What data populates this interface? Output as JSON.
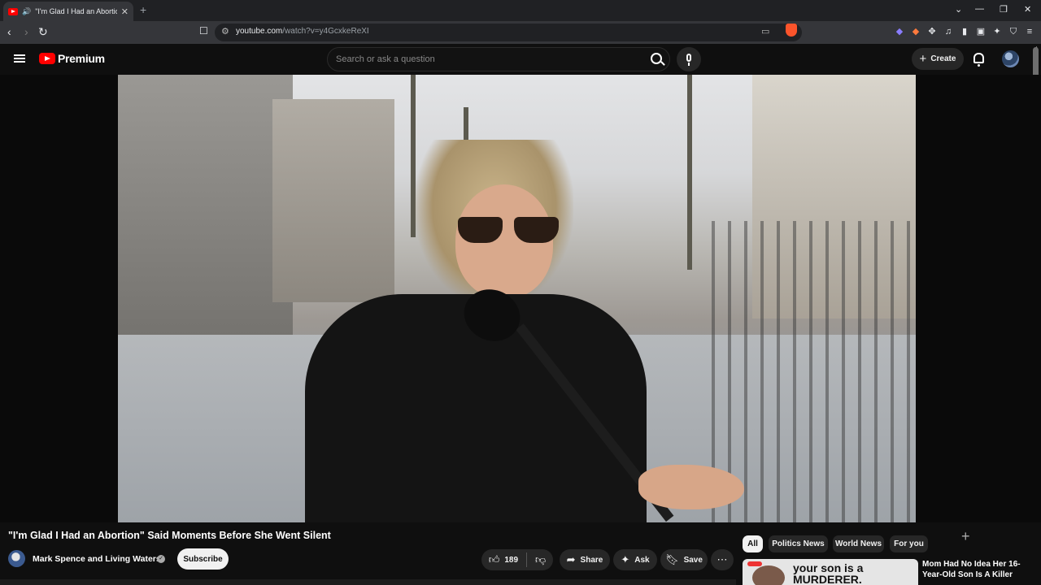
{
  "browser": {
    "tab_title": "\"I'm Glad I Had an Abortion\"",
    "url_host": "youtube.com",
    "url_path": "/watch?v=y4GcxkeReXI"
  },
  "youtube": {
    "logo_text": "Premium",
    "search_placeholder": "Search or ask a question",
    "create_label": "Create"
  },
  "video": {
    "title": "\"I'm Glad I Had an Abortion\" Said Moments Before She Went Silent",
    "channel_name": "Mark Spence and Living Waters",
    "subscribe_label": "Subscribe",
    "like_count": "189",
    "share_label": "Share",
    "ask_label": "Ask",
    "save_label": "Save"
  },
  "chips": [
    "All",
    "Politics News",
    "World News",
    "For you"
  ],
  "recommendation": {
    "thumb_text": "your son is a MURDERER.",
    "title": "Mom Had No Idea Her 16-Year-Old Son Is A Killer"
  },
  "icons": [
    "search-icon",
    "mic-icon",
    "bell-icon",
    "like-icon",
    "dislike-icon",
    "share-icon",
    "sparkle-icon",
    "bookmark-icon",
    "more-icon",
    "hamburger-icon"
  ]
}
